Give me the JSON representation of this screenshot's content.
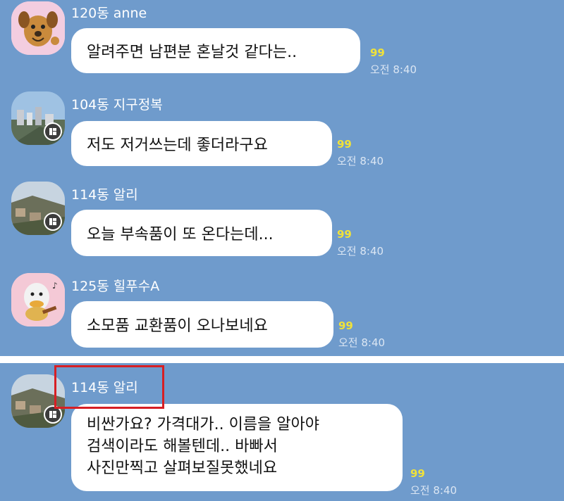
{
  "chat": {
    "messages": [
      {
        "avatar": "dog-character-icon",
        "sender": "120동 anne",
        "text": [
          "알려주면 남편분 혼날것 같다는.."
        ],
        "unread": "99",
        "time": "오전 8:40"
      },
      {
        "avatar": "city-view-photo-icon",
        "sender": "104동 지구정복",
        "text": [
          "저도 저거쓰는데 좋더라구요"
        ],
        "unread": "99",
        "time": "오전 8:40"
      },
      {
        "avatar": "hillside-photo-icon",
        "sender": "114동 알리",
        "text": [
          "오늘 부속품이 또 온다는데..."
        ],
        "unread": "99",
        "time": "오전 8:40"
      },
      {
        "avatar": "duck-guitar-icon",
        "sender": "125동 힐푸수A",
        "text": [
          "소모품 교환품이 오나보네요"
        ],
        "unread": "99",
        "time": "오전 8:40"
      },
      {
        "avatar": "hillside-photo-icon",
        "sender": "114동 알리",
        "text": [
          "비싼가요? 가격대가.. 이름을 알아야",
          "검색이라도 해볼텐데.. 바빠서",
          "사진만찍고 살펴보질못했네요"
        ],
        "unread": "99",
        "time": "오전 8:40"
      }
    ]
  },
  "colors": {
    "background": "#6f9bcc",
    "bubble": "#ffffff",
    "unread": "#f0e23a",
    "highlight": "#d71f24"
  }
}
